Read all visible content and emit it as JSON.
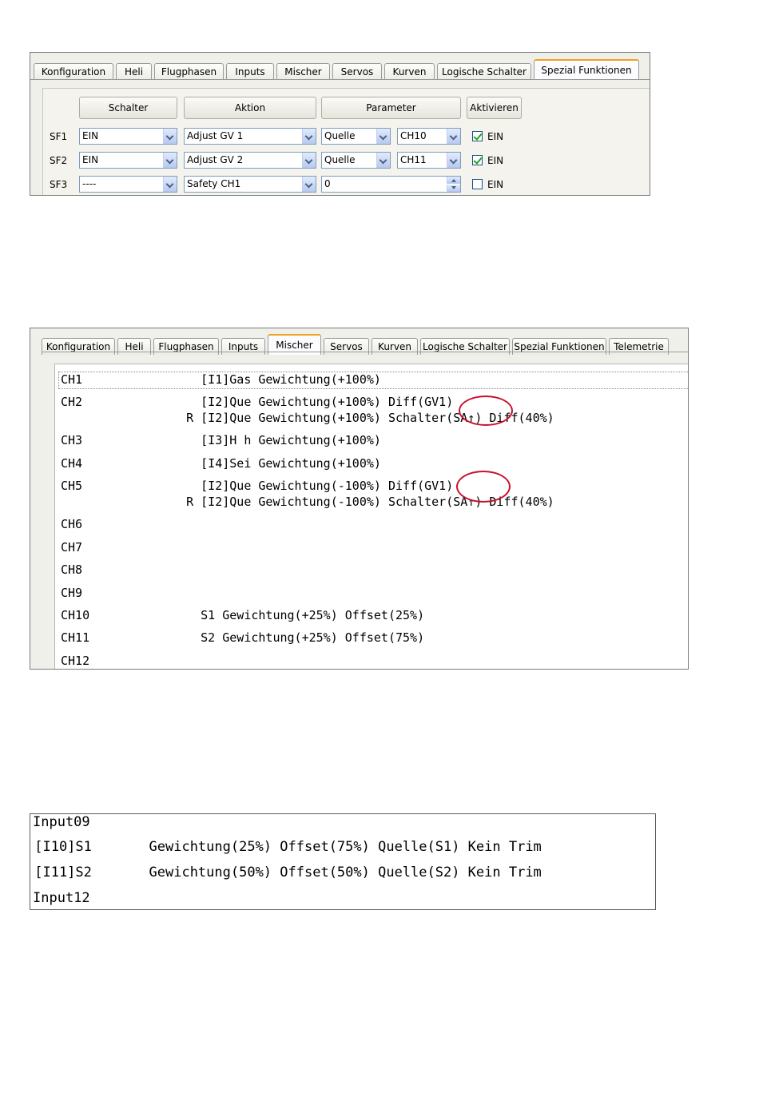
{
  "panel1": {
    "tabs": [
      "Konfiguration",
      "Heli",
      "Flugphasen",
      "Inputs",
      "Mischer",
      "Servos",
      "Kurven",
      "Logische Schalter",
      "Spezial Funktionen"
    ],
    "active_tab": "Spezial Funktionen",
    "headers": {
      "schalter": "Schalter",
      "aktion": "Aktion",
      "parameter": "Parameter",
      "aktivieren": "Aktivieren"
    },
    "rows": [
      {
        "label": "SF1",
        "schalter": "EIN",
        "aktion": "Adjust GV 1",
        "param_source": "Quelle",
        "param_value": "CH10",
        "enabled": true,
        "enabled_label": "EIN"
      },
      {
        "label": "SF2",
        "schalter": "EIN",
        "aktion": "Adjust GV 2",
        "param_source": "Quelle",
        "param_value": "CH11",
        "enabled": true,
        "enabled_label": "EIN"
      },
      {
        "label": "SF3",
        "schalter": "----",
        "aktion": "Safety CH1",
        "param_number": "0",
        "enabled": false,
        "enabled_label": "EIN"
      }
    ]
  },
  "panel2": {
    "tabs": [
      "Konfiguration",
      "Heli",
      "Flugphasen",
      "Inputs",
      "Mischer",
      "Servos",
      "Kurven",
      "Logische Schalter",
      "Spezial Funktionen",
      "Telemetrie"
    ],
    "active_tab": "Mischer",
    "lines": [
      {
        "ch": "CH1",
        "text": "     [I1]Gas Gewichtung(+100%)"
      },
      {
        "ch": "CH2",
        "text": "     [I2]Que Gewichtung(+100%) Diff(GV1)"
      },
      {
        "ch": "",
        "text": "   R [I2]Que Gewichtung(+100%) Schalter(SA↑) Diff(40%)"
      },
      {
        "ch": "CH3",
        "text": "     [I3]H h Gewichtung(+100%)"
      },
      {
        "ch": "CH4",
        "text": "     [I4]Sei Gewichtung(+100%)"
      },
      {
        "ch": "CH5",
        "text": "     [I2]Que Gewichtung(-100%) Diff(GV1)"
      },
      {
        "ch": "",
        "text": "   R [I2]Que Gewichtung(-100%) Schalter(SA↑) Diff(40%)"
      },
      {
        "ch": "CH6",
        "text": ""
      },
      {
        "ch": "CH7",
        "text": ""
      },
      {
        "ch": "CH8",
        "text": ""
      },
      {
        "ch": "CH9",
        "text": ""
      },
      {
        "ch": "CH10",
        "text": "     S1 Gewichtung(+25%) Offset(25%)"
      },
      {
        "ch": "CH11",
        "text": "     S2 Gewichtung(+25%) Offset(75%)"
      },
      {
        "ch": "CH12",
        "text": ""
      }
    ],
    "highlight_color": "#c8102e"
  },
  "panel3": {
    "lines": [
      "Input09",
      " [I10]S1       Gewichtung(25%) Offset(75%) Quelle(S1) Kein Trim",
      " [I11]S2       Gewichtung(50%) Offset(50%) Quelle(S2) Kein Trim",
      "Input12"
    ]
  }
}
